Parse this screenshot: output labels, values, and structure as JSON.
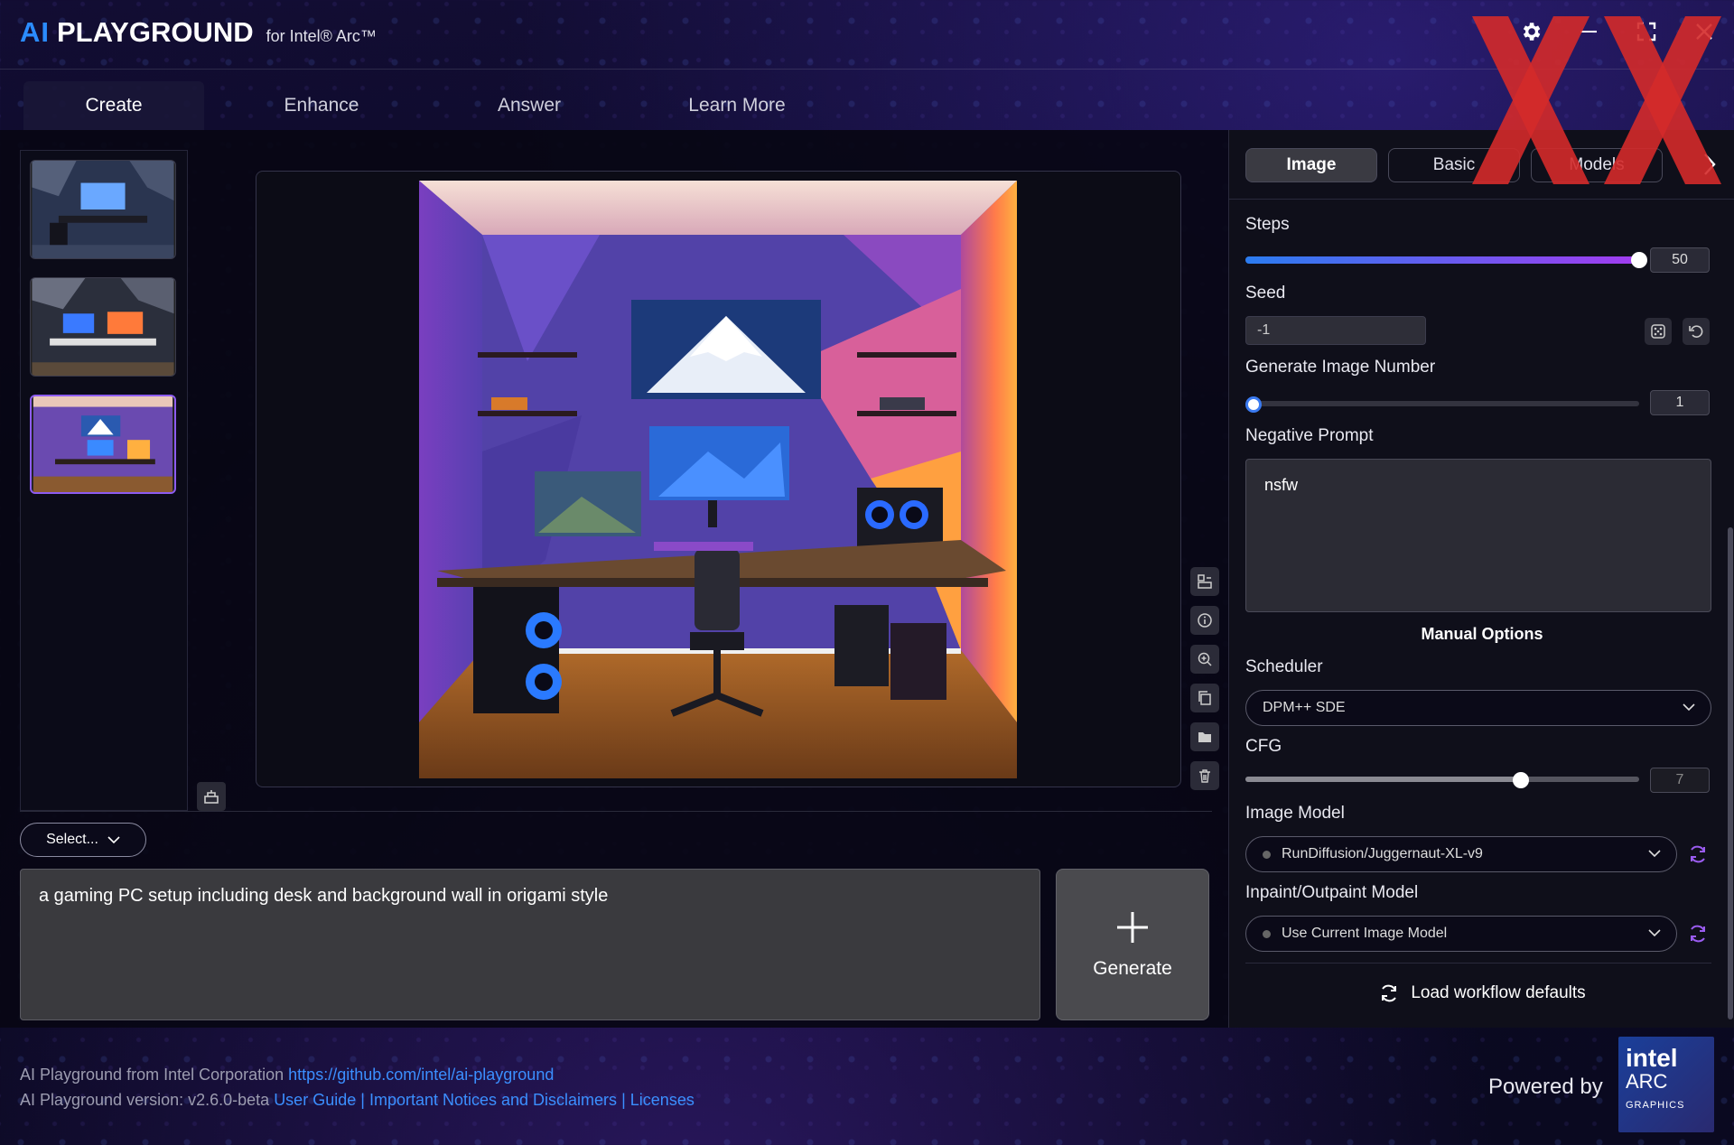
{
  "app": {
    "brand_ai": "AI",
    "brand_name": "PLAYGROUND",
    "brand_sub": "for Intel® Arc™"
  },
  "tabs": [
    {
      "label": "Create",
      "active": true
    },
    {
      "label": "Enhance",
      "active": false
    },
    {
      "label": "Answer",
      "active": false
    },
    {
      "label": "Learn More",
      "active": false
    }
  ],
  "select": {
    "label": "Select..."
  },
  "prompt": {
    "value": "a gaming PC setup including desk and background wall in origami style"
  },
  "generate": {
    "label": "Generate"
  },
  "panel": {
    "tabs": [
      {
        "label": "Image",
        "active": true
      },
      {
        "label": "Basic",
        "active": false
      },
      {
        "label": "Models",
        "active": false
      }
    ],
    "steps": {
      "label": "Steps",
      "value": "50",
      "fraction": 1.0
    },
    "seed": {
      "label": "Seed",
      "value": "-1"
    },
    "image_number": {
      "label": "Generate Image Number",
      "value": "1",
      "fraction": 0.0
    },
    "negative_prompt": {
      "label": "Negative Prompt",
      "value": "nsfw"
    },
    "manual_options": "Manual Options",
    "scheduler": {
      "label": "Scheduler",
      "value": "DPM++ SDE"
    },
    "cfg": {
      "label": "CFG",
      "value": "7",
      "fraction": 0.7
    },
    "image_model": {
      "label": "Image Model",
      "value": "RunDiffusion/Juggernaut-XL-v9"
    },
    "inpaint_model": {
      "label": "Inpaint/Outpaint Model",
      "value": "Use Current Image Model"
    },
    "load_defaults": "Load workflow defaults"
  },
  "footer": {
    "line1_text": "AI Playground from Intel Corporation",
    "line1_link": "https://github.com/intel/ai-playground",
    "line2_text": "AI Playground version: v2.6.0-beta",
    "user_guide": "User Guide",
    "notices": "Important Notices and Disclaimers",
    "licenses": "Licenses",
    "separator": "|",
    "powered_by": "Powered by",
    "badge_l1": "intel",
    "badge_l2": "ARC",
    "badge_l3": "GRAPHICS"
  },
  "colors": {
    "accent_blue": "#2b8cff",
    "slider_start": "#2b7cf0",
    "slider_end": "#a23cf0",
    "selected_thumb": "#8d5cf0"
  },
  "icons": [
    "gear-icon",
    "minimize-icon",
    "fullscreen-icon",
    "close-icon",
    "dice-icon",
    "reset-icon",
    "refresh-icon",
    "chevron-down-icon",
    "chevron-right-icon",
    "plus-icon",
    "info-icon",
    "zoom-icon",
    "copy-icon",
    "folder-icon",
    "trash-icon",
    "compare-icon",
    "grid-icon"
  ]
}
